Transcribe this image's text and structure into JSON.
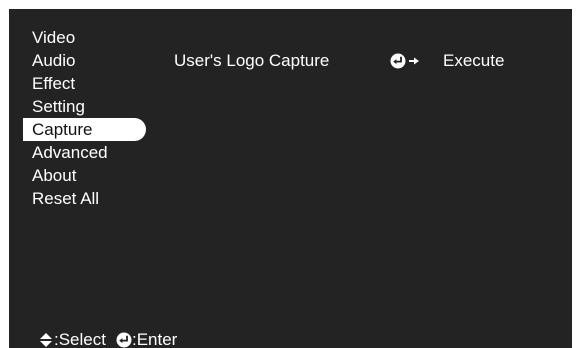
{
  "menu": {
    "items": [
      {
        "label": "Video"
      },
      {
        "label": "Audio"
      },
      {
        "label": "Effect"
      },
      {
        "label": "Setting"
      },
      {
        "label": "Capture"
      },
      {
        "label": "Advanced"
      },
      {
        "label": "About"
      },
      {
        "label": "Reset All"
      }
    ],
    "selected": "Capture"
  },
  "content": {
    "rows": [
      {
        "label": "User's Logo Capture",
        "icon": "enter-arrow-icon",
        "value": "Execute"
      }
    ]
  },
  "footer": {
    "select_icon": "up-down-arrow-icon",
    "select_label": ":Select",
    "enter_icon": "enter-icon",
    "enter_label": ":Enter"
  },
  "colors": {
    "background": "#232323",
    "text": "#ffffff",
    "highlight": "#ffffff",
    "highlight_text": "#111111"
  }
}
